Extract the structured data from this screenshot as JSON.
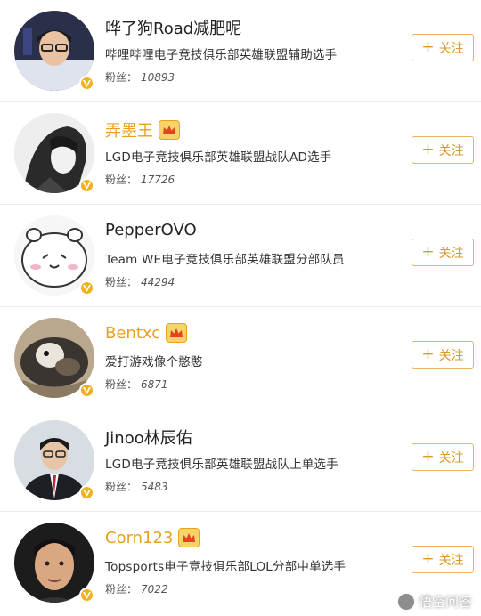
{
  "fans_label": "粉丝：",
  "follow_label": "关注",
  "follow_plus": "+",
  "accent_color": "#e8a020",
  "users": [
    {
      "name": "哗了狗Road减肥呢",
      "vip": false,
      "desc": "哔哩哔哩电子竞技俱乐部英雄联盟辅助选手",
      "fans": "10893"
    },
    {
      "name": "弄墨王",
      "vip": true,
      "desc": "LGD电子竞技俱乐部英雄联盟战队AD选手",
      "fans": "17726"
    },
    {
      "name": "PepperOVO",
      "vip": false,
      "desc": "Team WE电子竞技俱乐部英雄联盟分部队员",
      "fans": "44294"
    },
    {
      "name": "Bentxc",
      "vip": true,
      "desc": "爱打游戏像个憨憨",
      "fans": "6871"
    },
    {
      "name": "Jinoo林辰佑",
      "vip": false,
      "desc": "LGD电子竞技俱乐部英雄联盟战队上单选手",
      "fans": "5483"
    },
    {
      "name": "Corn123",
      "vip": true,
      "desc": "Topsports电子竞技俱乐部LOL分部中单选手",
      "fans": "7022"
    }
  ],
  "watermark": "悟空问答"
}
